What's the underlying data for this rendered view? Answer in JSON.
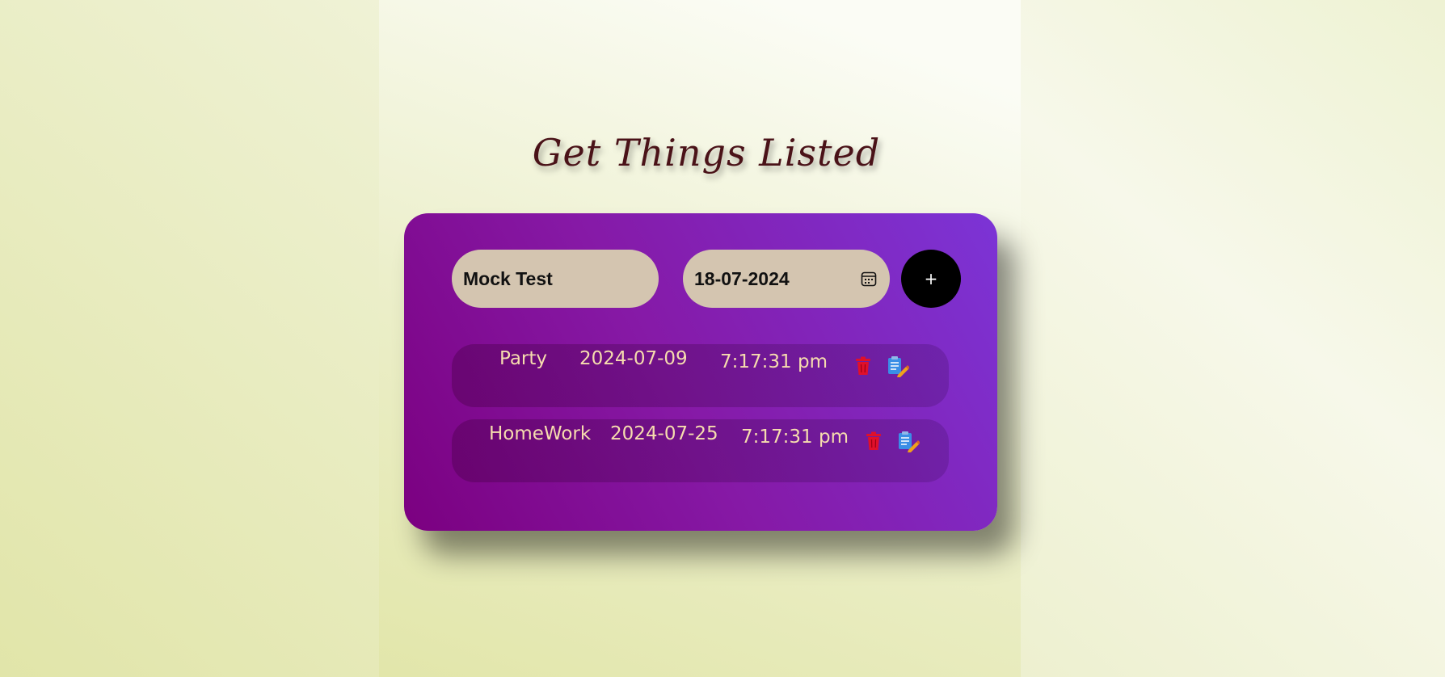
{
  "header": {
    "title": "Get Things Listed"
  },
  "form": {
    "task_value": "Mock Test",
    "date_value": "18-07-2024",
    "add_label": "+"
  },
  "todos": [
    {
      "name": "Party",
      "date": "2024-07-09",
      "time": "7:17:31 pm"
    },
    {
      "name": "HomeWork",
      "date": "2024-07-25",
      "time": "7:17:31 pm"
    }
  ],
  "icons": {
    "calendar": "calendar-icon",
    "delete": "trash-icon",
    "edit": "edit-icon"
  },
  "colors": {
    "title": "#4a1218",
    "card_start": "#7b0080",
    "card_end": "#7c34d6",
    "input_bg": "#d4c5b0",
    "row_text": "#f6dcae",
    "delete": "#e0102a",
    "add_button": "#000000"
  }
}
